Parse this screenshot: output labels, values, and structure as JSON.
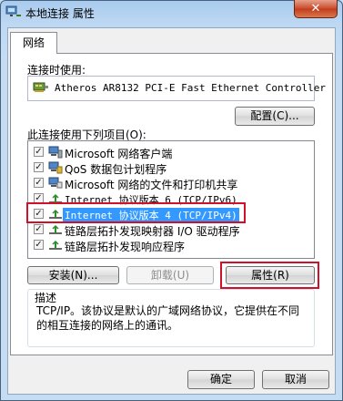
{
  "window": {
    "title": "本地连接 属性",
    "close_symbol": "✕"
  },
  "tabs": [
    {
      "label": "网络"
    }
  ],
  "connect_using": {
    "label": "连接时使用:",
    "adapter_name": "Atheros AR8132 PCI-E Fast Ethernet Controller",
    "configure_label": "配置(C)..."
  },
  "items_section": {
    "label": "此连接使用下列项目(O):",
    "items": [
      {
        "label": "Microsoft 网络客户端",
        "checked": true,
        "icon": "network-client-icon"
      },
      {
        "label": "QoS 数据包计划程序",
        "checked": true,
        "icon": "qos-scheduler-icon"
      },
      {
        "label": "Microsoft 网络的文件和打印机共享",
        "checked": true,
        "icon": "file-printer-sharing-icon"
      },
      {
        "label": "Internet 协议版本 6 (TCP/IPv6)",
        "checked": true,
        "icon": "protocol-icon"
      },
      {
        "label": "Internet 协议版本 4 (TCP/IPv4)",
        "checked": true,
        "icon": "protocol-icon",
        "selected": true
      },
      {
        "label": "链路层拓扑发现映射器 I/O 驱动程序",
        "checked": true,
        "icon": "protocol-icon"
      },
      {
        "label": "链路层拓扑发现响应程序",
        "checked": true,
        "icon": "protocol-icon"
      }
    ]
  },
  "buttons": {
    "install": "安装(N)...",
    "uninstall": "卸载(U)",
    "properties": "属性(R)",
    "ok": "确定",
    "cancel": "取消"
  },
  "description": {
    "title": "描述",
    "text": "TCP/IP。该协议是默认的广域网络协议，它提供在不同的相互连接的网络上的通讯。"
  },
  "colors": {
    "highlight": "#3399ff",
    "annotation_red": "#d0112b"
  }
}
